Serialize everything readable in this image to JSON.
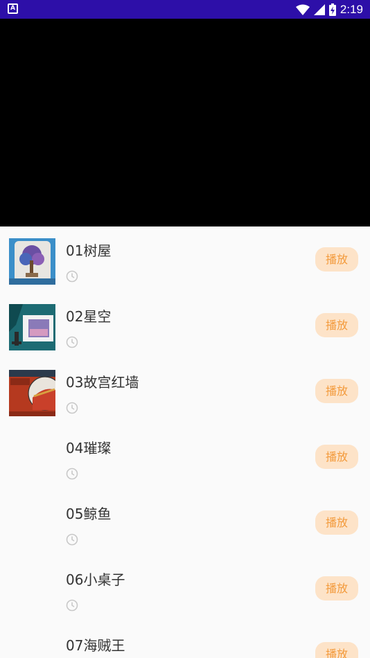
{
  "status_bar": {
    "time": "2:19",
    "app_icon_letter": "A"
  },
  "items": [
    {
      "title": "01树屋",
      "button": "播放",
      "thumbnail": "tree-house"
    },
    {
      "title": "02星空",
      "button": "播放",
      "thumbnail": "starry-sky"
    },
    {
      "title": "03故宫红墙",
      "button": "播放",
      "thumbnail": "palace-red-wall"
    },
    {
      "title": "04璀璨",
      "button": "播放",
      "thumbnail": ""
    },
    {
      "title": "05鲸鱼",
      "button": "播放",
      "thumbnail": ""
    },
    {
      "title": "06小桌子",
      "button": "播放",
      "thumbnail": ""
    },
    {
      "title": "07海贼王",
      "button": "播放",
      "thumbnail": ""
    }
  ],
  "colors": {
    "status_bar": "#2d0fa8",
    "button_bg": "#fde3c8",
    "button_text": "#f39a3b"
  }
}
